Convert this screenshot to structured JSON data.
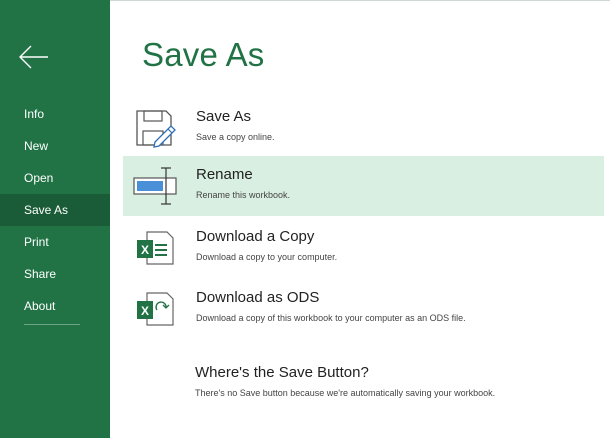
{
  "sidebar": {
    "back_icon": "back-arrow-icon",
    "items": [
      {
        "label": "Info"
      },
      {
        "label": "New"
      },
      {
        "label": "Open"
      },
      {
        "label": "Save As",
        "active": true
      },
      {
        "label": "Print"
      },
      {
        "label": "Share"
      },
      {
        "label": "About"
      }
    ]
  },
  "main": {
    "title": "Save As",
    "options": [
      {
        "title": "Save As",
        "description": "Save a copy online.",
        "icon": "save-as-icon"
      },
      {
        "title": "Rename",
        "description": "Rename this workbook.",
        "icon": "rename-icon",
        "selected": true
      },
      {
        "title": "Download a Copy",
        "description": "Download a copy to your computer.",
        "icon": "excel-download-icon"
      },
      {
        "title": "Download as ODS",
        "description": "Download a copy of this workbook to your computer as an ODS file.",
        "icon": "excel-ods-icon"
      }
    ],
    "help": {
      "title": "Where's the Save Button?",
      "description": "There's no Save button because we're automatically saving your workbook."
    }
  },
  "colors": {
    "sidebar_bg": "#217346",
    "sidebar_active": "#1a5c38",
    "selected_row": "#d9efe1",
    "accent": "#217346"
  }
}
